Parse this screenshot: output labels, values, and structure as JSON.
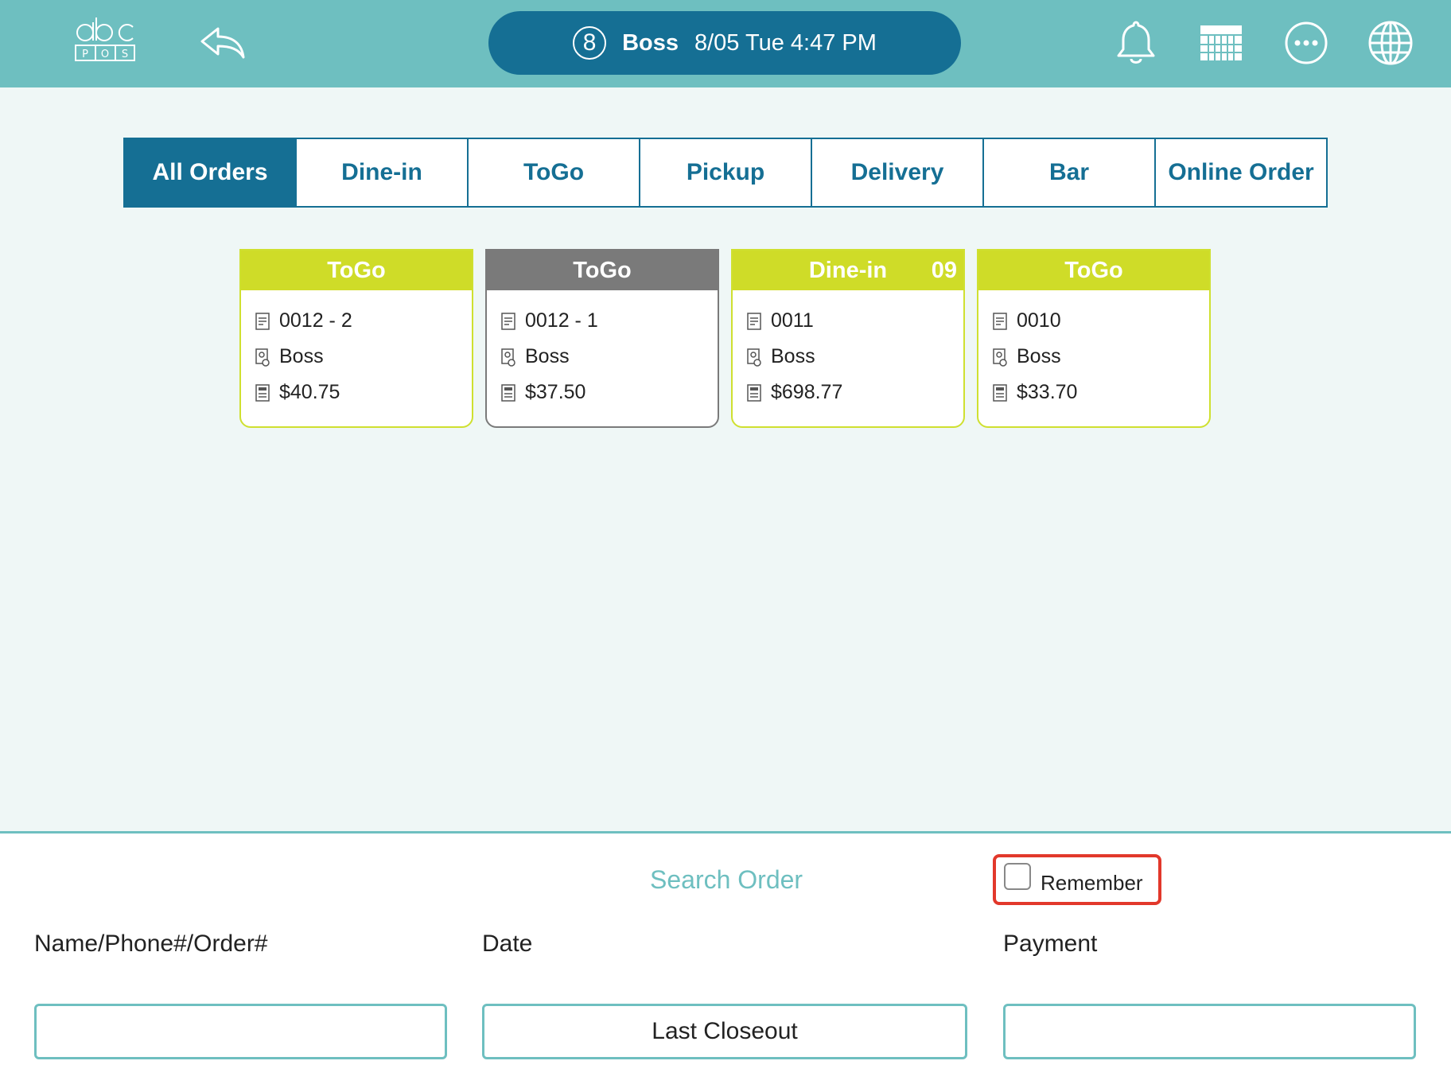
{
  "header": {
    "logo_icon": "abc-pos-logo-icon",
    "back_icon": "back-arrow-icon",
    "status": {
      "badge": "8",
      "user": "Boss",
      "datetime": "8/05 Tue 4:47 PM"
    },
    "icons": [
      "bell-icon",
      "calendar-grid-icon",
      "more-dots-icon",
      "globe-icon"
    ]
  },
  "tabs": [
    {
      "label": "All Orders",
      "active": true
    },
    {
      "label": "Dine-in",
      "active": false
    },
    {
      "label": "ToGo",
      "active": false
    },
    {
      "label": "Pickup",
      "active": false
    },
    {
      "label": "Delivery",
      "active": false
    },
    {
      "label": "Bar",
      "active": false
    },
    {
      "label": "Online Order",
      "active": false
    }
  ],
  "orders": [
    {
      "type": "ToGo",
      "table": "",
      "order_no": "0012 - 2",
      "server": "Boss",
      "total": "$40.75",
      "state_color": "#cfdc28"
    },
    {
      "type": "ToGo",
      "table": "",
      "order_no": "0012 - 1",
      "server": "Boss",
      "total": "$37.50",
      "state_color": "#7a7a7a"
    },
    {
      "type": "Dine-in",
      "table": "09",
      "order_no": "0011",
      "server": "Boss",
      "total": "$698.77",
      "state_color": "#cfdc28"
    },
    {
      "type": "ToGo",
      "table": "",
      "order_no": "0010",
      "server": "Boss",
      "total": "$33.70",
      "state_color": "#cfdc28"
    }
  ],
  "search": {
    "title": "Search Order",
    "remember_label": "Remember",
    "remember_checked": false,
    "name_label": "Name/Phone#/Order#",
    "name_value": "",
    "date_label": "Date",
    "date_value": "Last Closeout",
    "payment_label": "Payment",
    "payment_value": ""
  },
  "colors": {
    "header_bg": "#6ebfc0",
    "primary": "#156f94",
    "card_active": "#cfdc28",
    "card_inactive": "#7a7a7a",
    "highlight": "#e2382b"
  }
}
